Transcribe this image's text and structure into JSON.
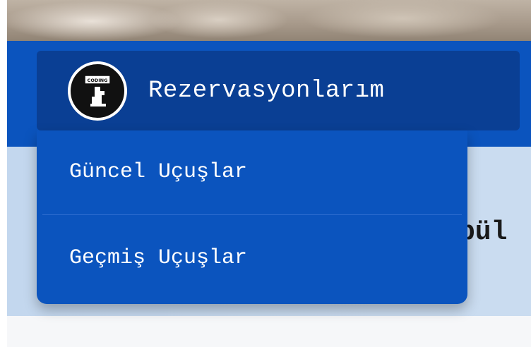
{
  "page": {
    "title_fragment": "pül"
  },
  "dropdown": {
    "toggle_label": "Rezervasyonlarım",
    "avatar_text": "CODING",
    "items": [
      {
        "label": "Güncel Uçuşlar"
      },
      {
        "label": "Geçmiş Uçuşlar"
      }
    ]
  },
  "colors": {
    "navbar": "#0b54be",
    "toggle": "#0a3f94",
    "menu": "#0b54be",
    "band": "#c9dbef"
  }
}
